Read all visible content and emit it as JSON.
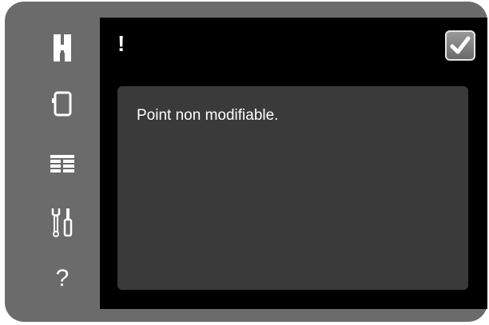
{
  "sidebar": {
    "items": [
      {
        "icon": "presser-foot-icon"
      },
      {
        "icon": "screen-icon"
      },
      {
        "icon": "menu-list-icon"
      },
      {
        "icon": "tools-icon"
      },
      {
        "icon": "help-icon",
        "label": "?"
      }
    ]
  },
  "header": {
    "alert_symbol": "!",
    "ok_icon": "checkmark-icon"
  },
  "dialog": {
    "message": "Point non modifiable."
  },
  "colors": {
    "bezel": "#6b6b6b",
    "screen": "#000000",
    "panel": "#3a3a3a",
    "text": "#ffffff"
  }
}
